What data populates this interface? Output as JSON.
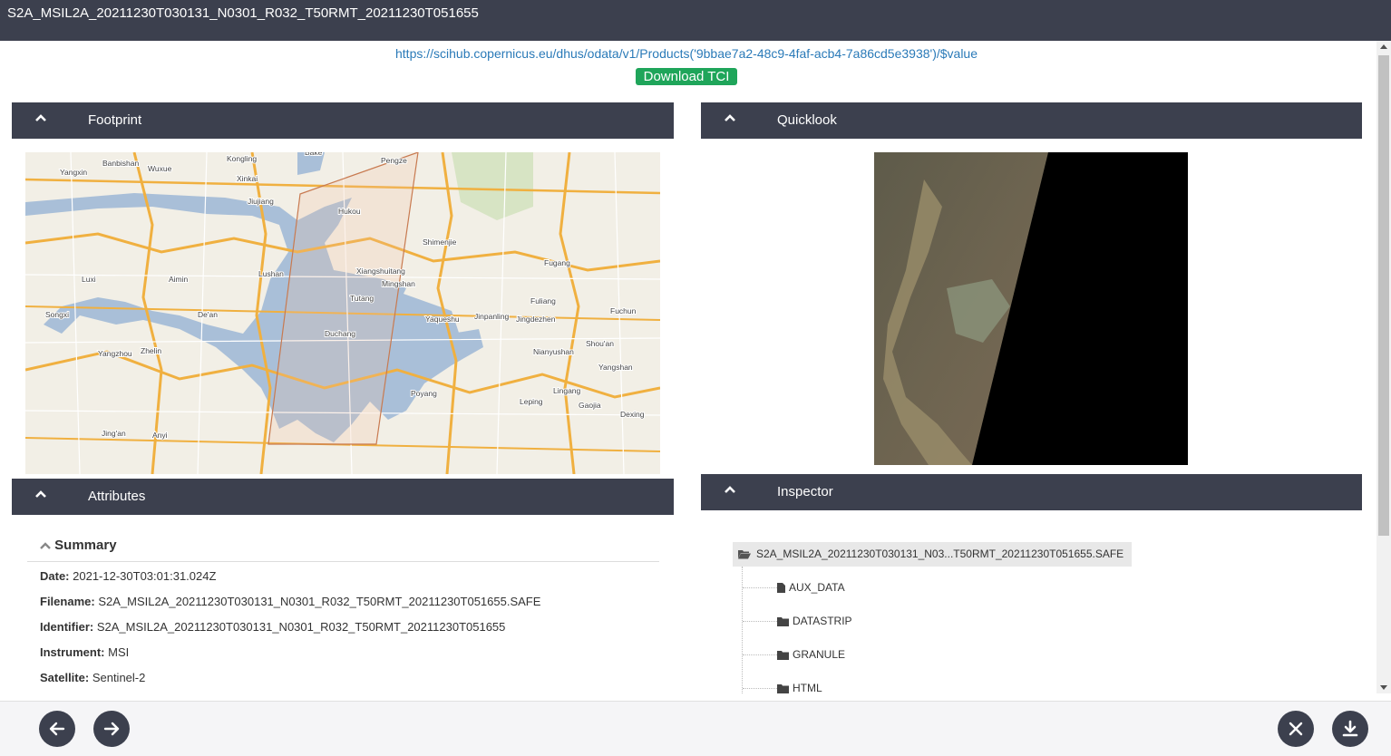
{
  "window": {
    "title": "S2A_MSIL2A_20211230T030131_N0301_R032_T50RMT_20211230T051655"
  },
  "product": {
    "url": "https://scihub.copernicus.eu/dhus/odata/v1/Products('9bbae7a2-48c9-4faf-acb4-7a86cd5e3938')/$value",
    "download_tci_label": "Download TCI"
  },
  "panels": {
    "footprint": "Footprint",
    "quicklook": "Quicklook",
    "attributes": "Attributes",
    "inspector": "Inspector"
  },
  "map": {
    "labels": [
      "Yangxin",
      "Wuxue",
      "Kongling",
      "Pengze",
      "Jiujiang",
      "Hukou",
      "Lushan",
      "Xiangshuitang",
      "Mingshan",
      "Fugang",
      "Tutang",
      "Shimenjie",
      "Fuliang",
      "Jingdezhen",
      "De'an",
      "Duchang",
      "Yaqueshu",
      "Jinpanling",
      "Fuchun",
      "Songxi",
      "Yangzhou",
      "Zhelin",
      "Nianyushan",
      "Shou'an",
      "Yangshan",
      "Poyang",
      "Leping",
      "Lingang",
      "Gaojia",
      "Dexing",
      "Jing'an",
      "Anyi",
      "Banbishan",
      "Aimin",
      "Luxi",
      "Bake",
      "Xinkai"
    ],
    "colors": {
      "land": "#f2efe6",
      "water": "#a9bfd8",
      "major_road": "#f0b040",
      "minor_road": "#ffffff",
      "forest": "#d7e4c4",
      "footprint_outline": "#c87a50"
    }
  },
  "attributes": {
    "summary_title": "Summary",
    "rows": [
      {
        "key": "Date:",
        "value": "2021-12-30T03:01:31.024Z"
      },
      {
        "key": "Filename:",
        "value": "S2A_MSIL2A_20211230T030131_N0301_R032_T50RMT_20211230T051655.SAFE"
      },
      {
        "key": "Identifier:",
        "value": "S2A_MSIL2A_20211230T030131_N0301_R032_T50RMT_20211230T051655"
      },
      {
        "key": "Instrument:",
        "value": "MSI"
      },
      {
        "key": "Satellite:",
        "value": "Sentinel-2"
      }
    ]
  },
  "inspector": {
    "root_label": "S2A_MSIL2A_20211230T030131_N03...T50RMT_20211230T051655.SAFE",
    "items": [
      {
        "label": "AUX_DATA",
        "icon": "file-icon"
      },
      {
        "label": "DATASTRIP",
        "icon": "folder-icon"
      },
      {
        "label": "GRANULE",
        "icon": "folder-icon"
      },
      {
        "label": "HTML",
        "icon": "folder-icon"
      }
    ]
  },
  "footer": {
    "icons": [
      "arrow-left-icon",
      "arrow-right-icon",
      "close-icon",
      "download-icon"
    ]
  }
}
